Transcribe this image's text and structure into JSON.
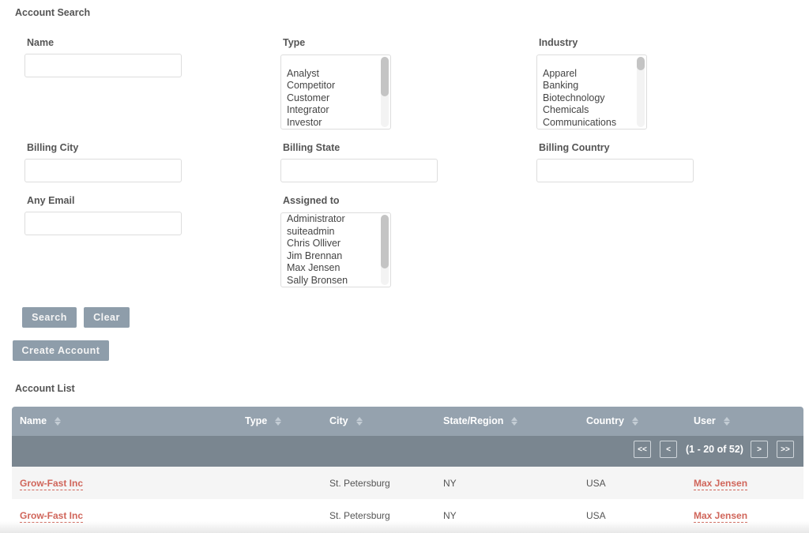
{
  "search": {
    "title": "Account Search",
    "fields": {
      "name": {
        "label": "Name",
        "value": ""
      },
      "type": {
        "label": "Type",
        "options": [
          "",
          "Analyst",
          "Competitor",
          "Customer",
          "Integrator",
          "Investor"
        ]
      },
      "industry": {
        "label": "Industry",
        "options": [
          "",
          "Apparel",
          "Banking",
          "Biotechnology",
          "Chemicals",
          "Communications"
        ]
      },
      "billing_city": {
        "label": "Billing City",
        "value": ""
      },
      "billing_state": {
        "label": "Billing State",
        "value": ""
      },
      "billing_country": {
        "label": "Billing Country",
        "value": ""
      },
      "any_email": {
        "label": "Any Email",
        "value": ""
      },
      "assigned_to": {
        "label": "Assigned to",
        "options": [
          "Administrator",
          "suiteadmin",
          "Chris Olliver",
          "Jim Brennan",
          "Max Jensen",
          "Sally Bronsen"
        ]
      }
    },
    "buttons": {
      "search": "Search",
      "clear": "Clear",
      "create": "Create Account"
    }
  },
  "list": {
    "title": "Account List",
    "columns": [
      "Name",
      "Type",
      "City",
      "State/Region",
      "Country",
      "User"
    ],
    "pagination": {
      "first": "<<",
      "prev": "<",
      "range": "(1 - 20 of 52)",
      "next": ">",
      "last": ">>"
    },
    "rows": [
      {
        "name": "Grow-Fast Inc",
        "type": "",
        "city": "St. Petersburg",
        "state": "NY",
        "country": "USA",
        "user": "Max Jensen"
      },
      {
        "name": "Grow-Fast Inc",
        "type": "",
        "city": "St. Petersburg",
        "state": "NY",
        "country": "USA",
        "user": "Max Jensen"
      }
    ]
  },
  "colors": {
    "button_bg": "#8e9daa",
    "header_bg": "#95a2ae",
    "pager_bg": "#7a8690",
    "link": "#d0655a"
  }
}
